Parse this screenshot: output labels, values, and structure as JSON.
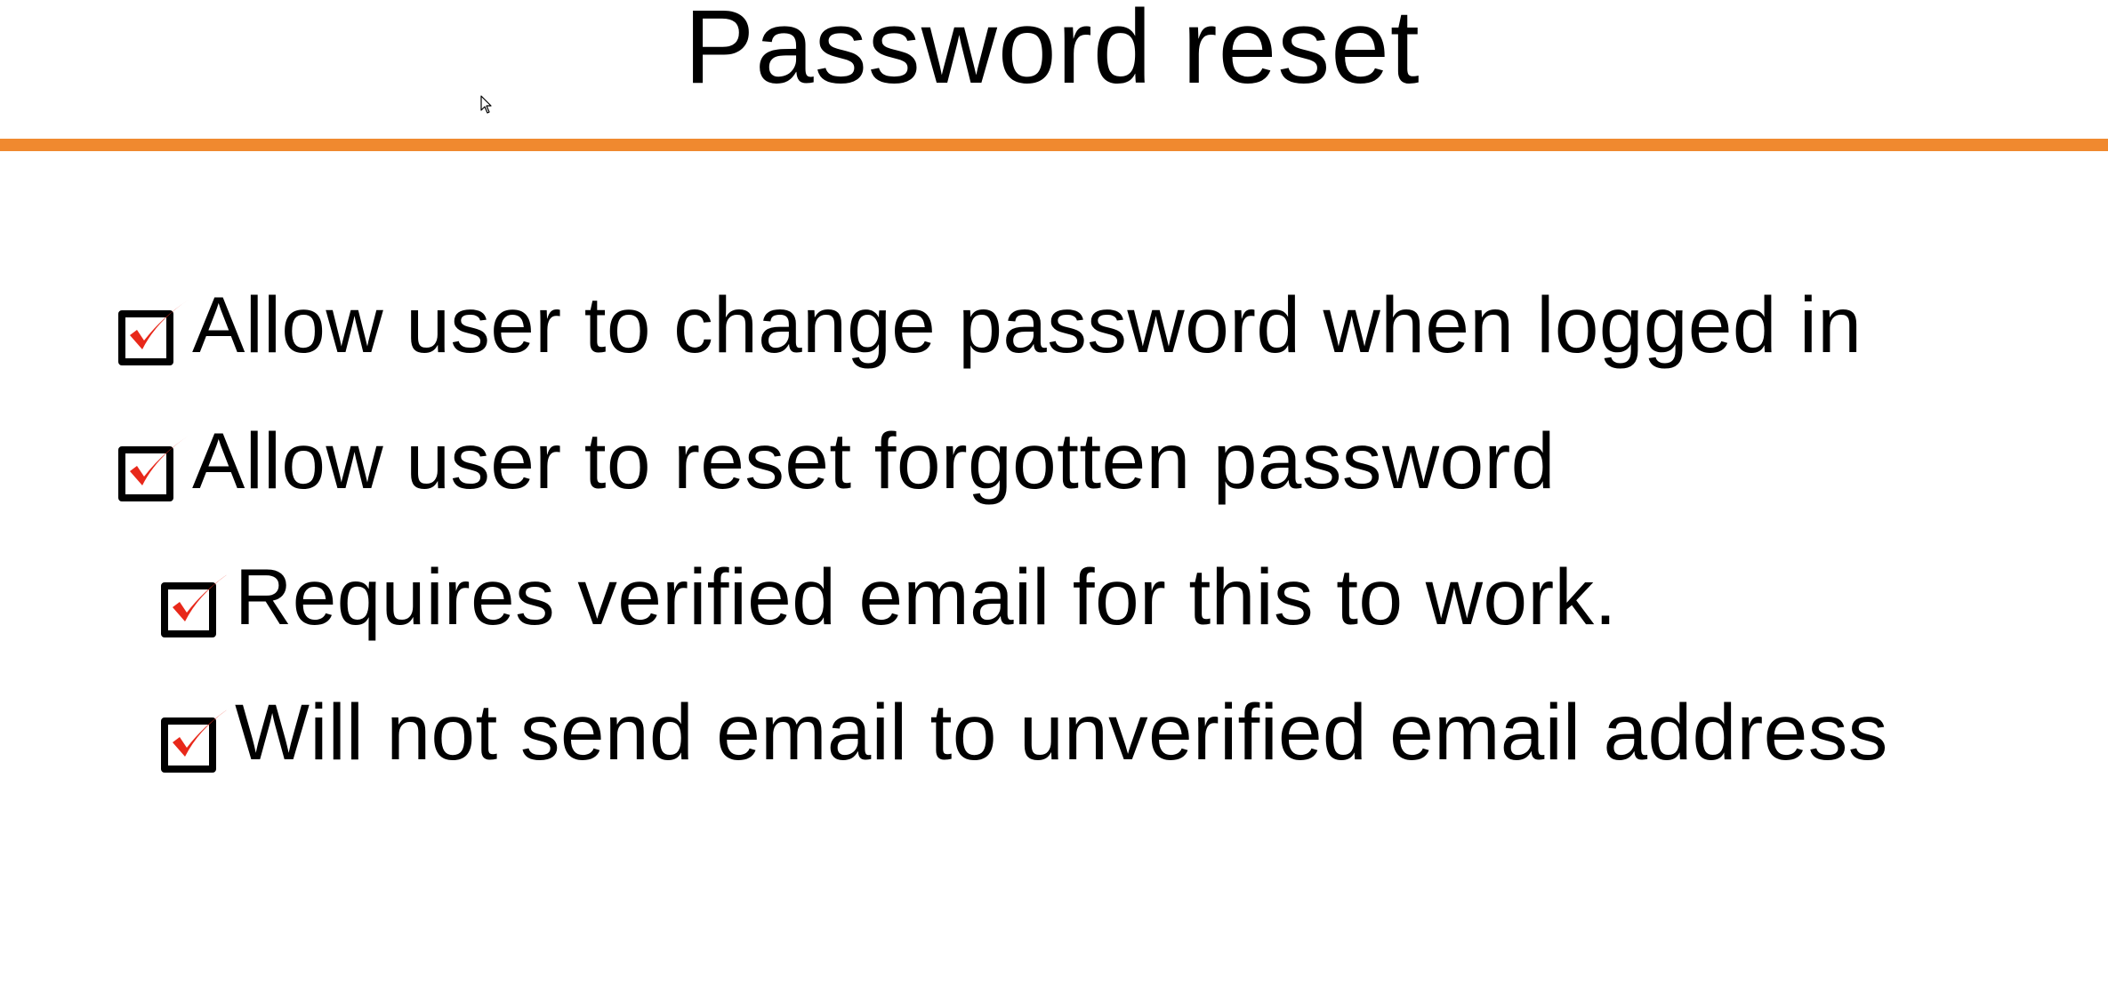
{
  "slide": {
    "title": "Password reset",
    "accent_color": "#f0892f",
    "check_color": "#e8281a",
    "bullets": [
      {
        "text": "Allow user to change password when logged in",
        "level": 1,
        "icon": "checked-box-icon"
      },
      {
        "text": "Allow user to reset forgotten password",
        "level": 1,
        "icon": "checked-box-icon"
      },
      {
        "text": "Requires verified email for this to work.",
        "level": 2,
        "icon": "checked-box-icon"
      },
      {
        "text": "Will not send email to unverified email address",
        "level": 2,
        "icon": "checked-box-icon"
      }
    ]
  },
  "cursor": {
    "icon": "mouse-pointer-icon"
  }
}
